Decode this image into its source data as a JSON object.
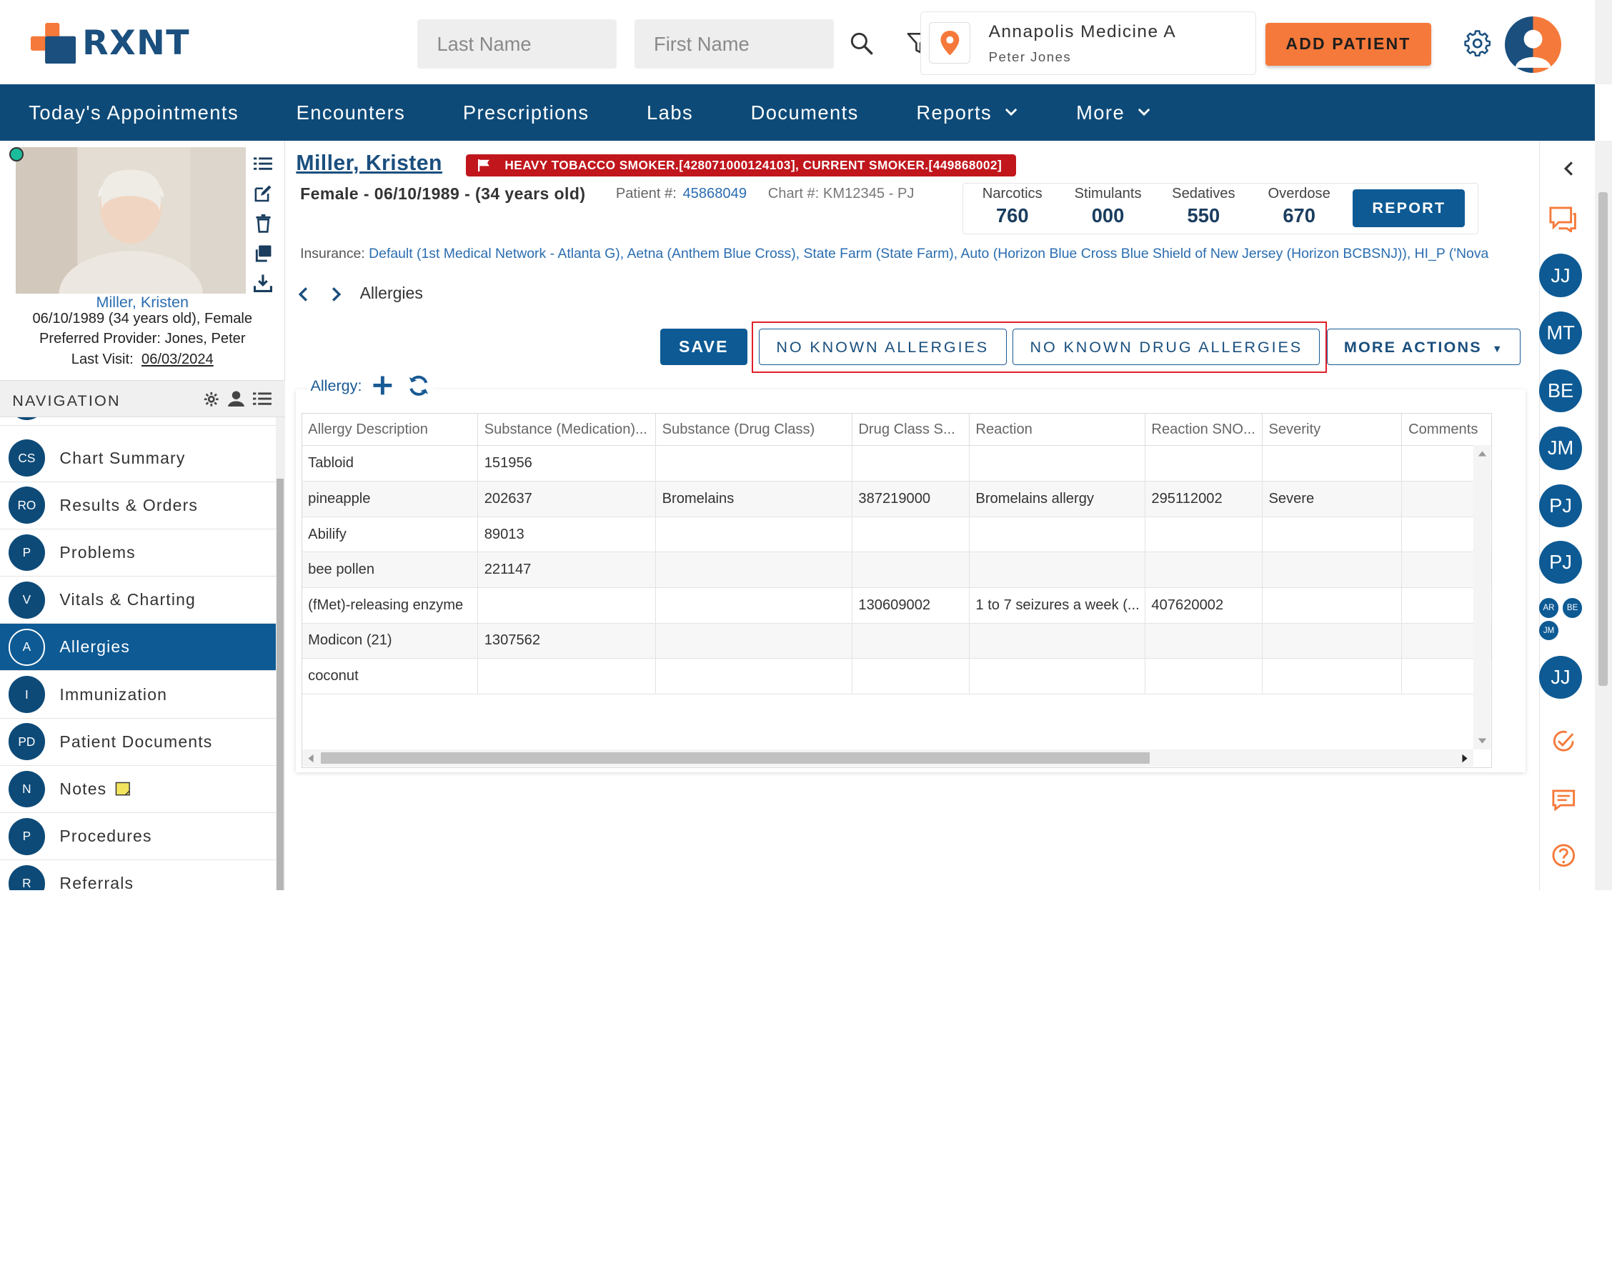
{
  "header": {
    "logo_text": "RXNT",
    "last_name_placeholder": "Last Name",
    "first_name_placeholder": "First Name",
    "location_name": "Annapolis Medicine A",
    "location_user": "Peter Jones",
    "add_patient_label": "ADD PATIENT"
  },
  "navbar": {
    "items": [
      "Today's Appointments",
      "Encounters",
      "Prescriptions",
      "Labs",
      "Documents",
      "Reports",
      "More"
    ]
  },
  "patient_card": {
    "name": "Miller, Kristen",
    "dob_line": "06/10/1989 (34 years old), Female",
    "provider_line": "Preferred Provider:  Jones, Peter",
    "last_visit_label": "Last Visit:",
    "last_visit_date": "06/03/2024"
  },
  "navigation": {
    "title": "NAVIGATION",
    "items": [
      {
        "abbr": "CS",
        "label": "Chart Summary"
      },
      {
        "abbr": "RO",
        "label": "Results & Orders"
      },
      {
        "abbr": "P",
        "label": "Problems"
      },
      {
        "abbr": "V",
        "label": "Vitals & Charting"
      },
      {
        "abbr": "A",
        "label": "Allergies"
      },
      {
        "abbr": "I",
        "label": "Immunization"
      },
      {
        "abbr": "PD",
        "label": "Patient Documents"
      },
      {
        "abbr": "N",
        "label": "Notes"
      },
      {
        "abbr": "P",
        "label": "Procedures"
      },
      {
        "abbr": "R",
        "label": "Referrals"
      }
    ],
    "active": "Allergies"
  },
  "patient_header": {
    "name": "Miller, Kristen",
    "alert": "HEAVY TOBACCO SMOKER.[428071000124103], CURRENT SMOKER.[449868002]",
    "demographics": "Female - 06/10/1989 - (34 years old)",
    "patient_num_label": "Patient #:",
    "patient_num": "45868049",
    "chart_num": "Chart #: KM12345 - PJ",
    "insurance_label": "Insurance:",
    "insurance_value": "Default (1st Medical Network - Atlanta G), Aetna (Anthem Blue Cross), State Farm (State Farm), Auto (Horizon Blue Cross Blue Shield of New Jersey (Horizon BCBSNJ)), HI_P ('Nova"
  },
  "pdmp": {
    "items": [
      {
        "label": "Narcotics",
        "value": "760"
      },
      {
        "label": "Stimulants",
        "value": "000"
      },
      {
        "label": "Sedatives",
        "value": "550"
      },
      {
        "label": "Overdose",
        "value": "670"
      }
    ],
    "report_label": "REPORT"
  },
  "page": {
    "breadcrumb": "Allergies",
    "save_label": "SAVE",
    "no_known_allergies_label": "NO KNOWN ALLERGIES",
    "no_known_drug_allergies_label": "NO KNOWN DRUG ALLERGIES",
    "more_actions_label": "MORE ACTIONS"
  },
  "allergy_grid": {
    "caption": "Allergy:",
    "columns": [
      "Allergy Description",
      "Substance (Medication)...",
      "Substance (Drug Class)",
      "Drug Class S...",
      "Reaction",
      "Reaction SNO...",
      "Severity",
      "Comments"
    ],
    "rows": [
      [
        "Tabloid",
        "151956",
        "",
        "",
        "",
        "",
        "",
        ""
      ],
      [
        "pineapple",
        "202637",
        "Bromelains",
        "387219000",
        "Bromelains allergy",
        "295112002",
        "Severe",
        ""
      ],
      [
        "Abilify",
        "89013",
        "",
        "",
        "",
        "",
        "",
        ""
      ],
      [
        "bee pollen",
        "221147",
        "",
        "",
        "",
        "",
        "",
        ""
      ],
      [
        "(fMet)-releasing enzyme",
        "",
        "",
        "130609002",
        "1 to 7 seizures a week (...",
        "407620002",
        "",
        ""
      ],
      [
        "Modicon (21)",
        "1307562",
        "",
        "",
        "",
        "",
        "",
        ""
      ],
      [
        "coconut",
        "",
        "",
        "",
        "",
        "",
        "",
        ""
      ]
    ]
  },
  "right_rail": {
    "avatars": [
      "JJ",
      "MT",
      "BE",
      "JM",
      "PJ",
      "PJ",
      "JJ"
    ],
    "mini_avatars": [
      "AR",
      "BE",
      "JM"
    ]
  },
  "colors": {
    "primary": "#0d4a78",
    "accent": "#f5793a",
    "alert": "#c0161c",
    "highlight": "#e0202a"
  }
}
